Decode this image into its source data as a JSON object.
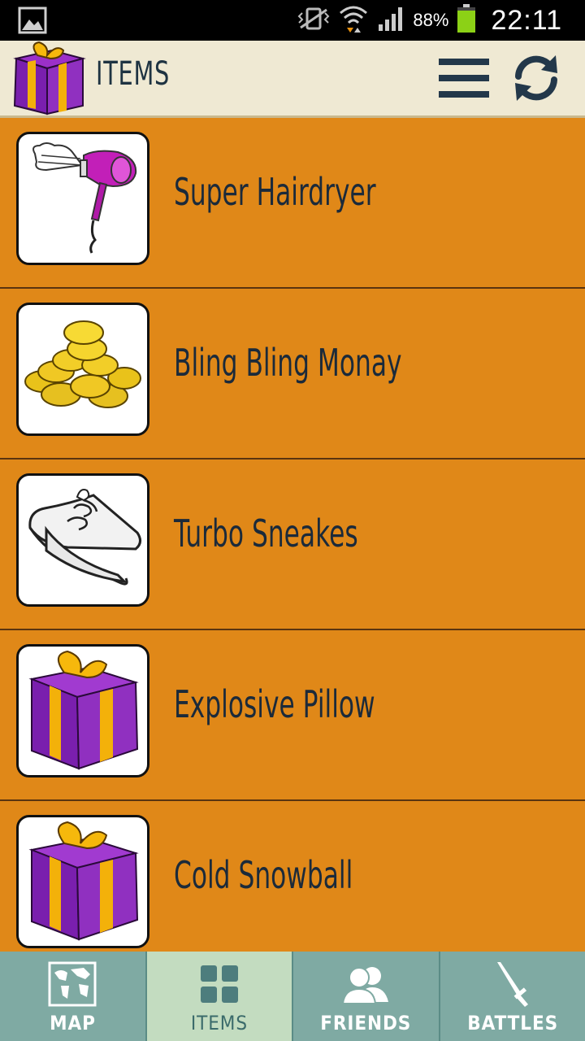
{
  "status_bar": {
    "battery_percent": "88%",
    "time": "22:11",
    "icons": [
      "gallery-icon",
      "vibrate-icon",
      "wifi-icon",
      "signal-icon",
      "battery-icon"
    ]
  },
  "app_bar": {
    "title": "ITEMS",
    "logo_icon": "gift-box-icon",
    "menu_icon": "hamburger-menu-icon",
    "refresh_icon": "refresh-icon"
  },
  "items": [
    {
      "label": "Super Hairdryer",
      "icon": "hairdryer-icon"
    },
    {
      "label": "Bling Bling Monay",
      "icon": "gold-coins-icon"
    },
    {
      "label": "Turbo Sneakes",
      "icon": "sneakers-icon"
    },
    {
      "label": "Explosive Pillow",
      "icon": "gift-box-icon"
    },
    {
      "label": "Cold Snowball",
      "icon": "gift-box-icon"
    }
  ],
  "bottom_nav": {
    "tabs": [
      {
        "label": "MAP",
        "icon": "world-map-icon",
        "active": false
      },
      {
        "label": "ITEMS",
        "icon": "grid-icon",
        "active": true
      },
      {
        "label": "FRIENDS",
        "icon": "people-icon",
        "active": false
      },
      {
        "label": "BATTLES",
        "icon": "sword-icon",
        "active": false
      }
    ]
  },
  "colors": {
    "list_background": "#e08818",
    "app_bar_background": "#efe9d3",
    "nav_background": "#7faaa3",
    "nav_active_background": "#c3dcc0",
    "text_dark": "#1b2a3a"
  }
}
